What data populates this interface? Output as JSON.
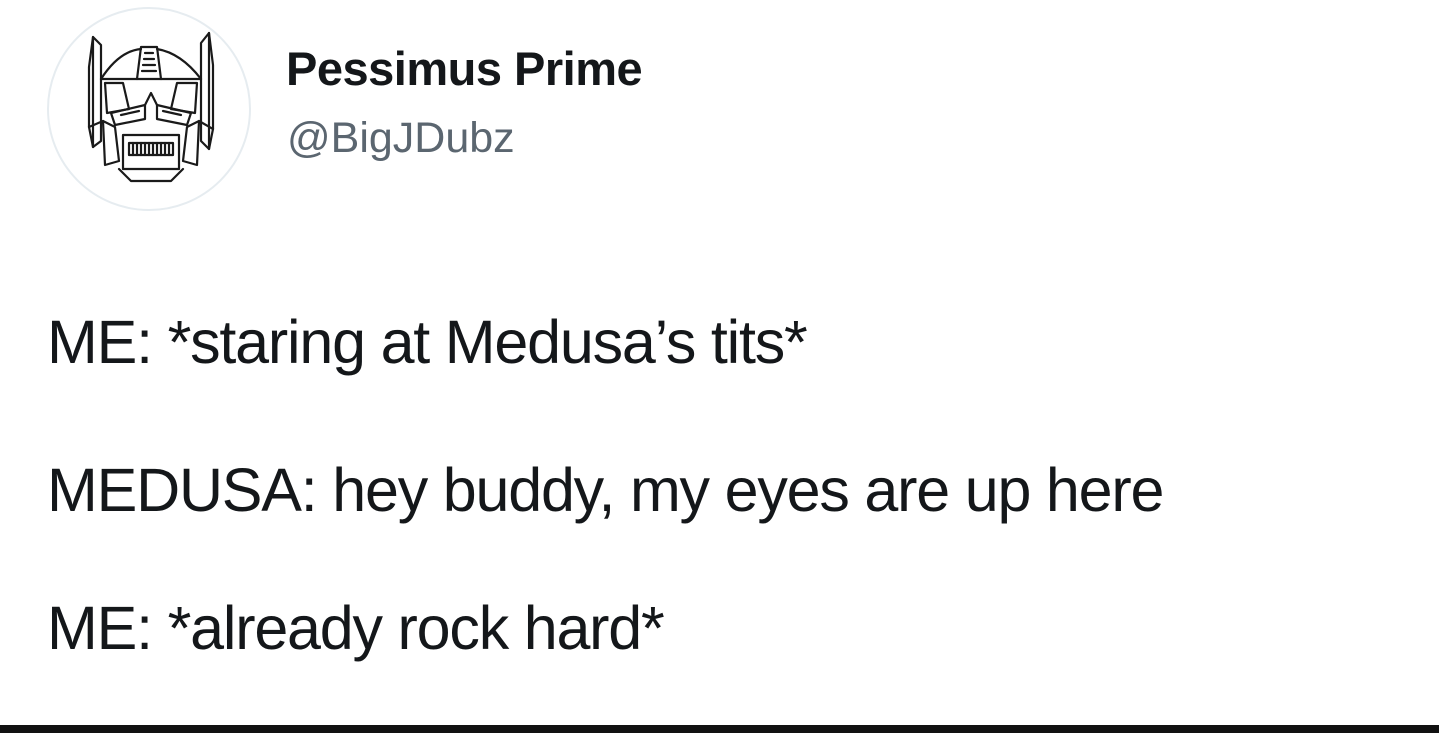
{
  "profile": {
    "display_name": "Pessimus Prime",
    "handle": "@BigJDubz",
    "avatar_icon": "robot-helmet-icon"
  },
  "tweet": {
    "lines": [
      "ME: *staring at Medusa’s tits*",
      "MEDUSA: hey buddy, my eyes are up here",
      "ME: *already rock hard*"
    ]
  },
  "colors": {
    "text": "#14171a",
    "handle": "#5b6670",
    "avatar_border": "#e6ecf0",
    "bottom_bar": "#111111"
  }
}
